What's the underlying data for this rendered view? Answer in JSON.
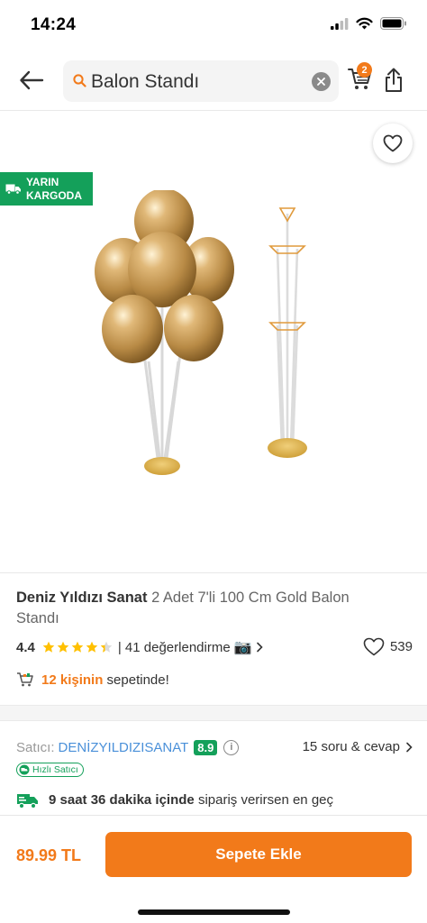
{
  "status_bar": {
    "time": "14:24"
  },
  "search": {
    "query": "Balon Standı"
  },
  "header": {
    "cart_count": "2"
  },
  "image_badge": {
    "line1": "YARIN",
    "line2": "KARGODA"
  },
  "product": {
    "brand": "Deniz Yıldızı Sanat",
    "name": "2 Adet 7'li 100 Cm Gold Balon Standı"
  },
  "rating": {
    "score": "4.4",
    "stars_value": 4.4,
    "stars_max": 5,
    "reviews": "| 41 değerlendirme",
    "likes": "539"
  },
  "basket": {
    "count_text": "12 kişinin",
    "suffix": "sepetinde!"
  },
  "seller": {
    "label": "Satıcı:",
    "name": "DENİZYILDIZISANAT",
    "score": "8.9",
    "qa_text": "15 soru & cevap",
    "fast_badge": "Hızlı Satıcı"
  },
  "delivery": {
    "bold": "9 saat 36 dakika içinde",
    "rest": "sipariş verirsen en geç"
  },
  "bottom": {
    "price": "89.99 TL",
    "add_to_cart": "Sepete Ekle"
  },
  "colors": {
    "accent": "#f27a1a",
    "green": "#14a05a",
    "link": "#4a90d9"
  },
  "icons": [
    "back-arrow-icon",
    "search-icon",
    "clear-icon",
    "cart-icon",
    "share-icon",
    "heart-icon",
    "truck-icon",
    "star-icon",
    "camera-icon",
    "basket-icon",
    "info-icon",
    "chevron-right-icon"
  ]
}
